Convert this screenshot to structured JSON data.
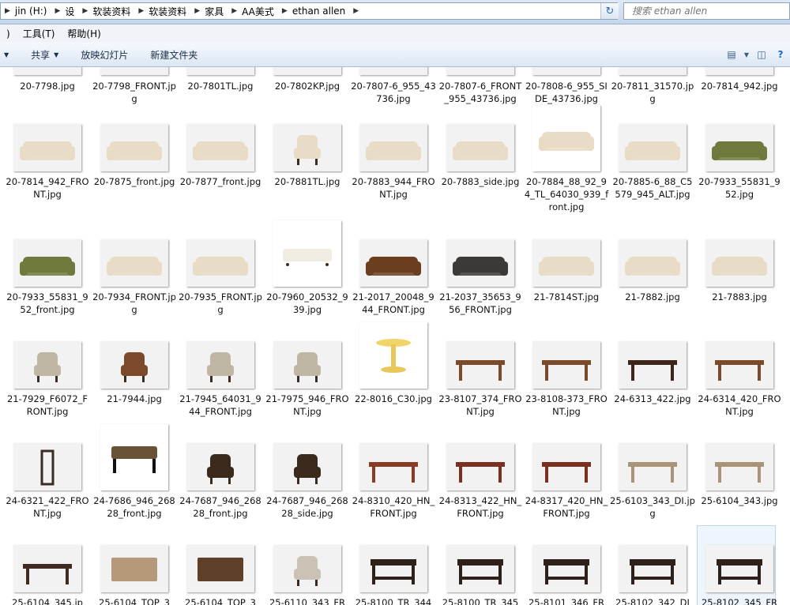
{
  "address": {
    "crumbs": [
      "jin (H:)",
      "设",
      "软装资料",
      "软装资料",
      "家具",
      "AA美式",
      "ethan allen"
    ],
    "search_placeholder": "搜索 ethan allen"
  },
  "menu": {
    "items": [
      ")",
      "工具(T)",
      "帮助(H)"
    ]
  },
  "commands": {
    "share": "共享",
    "slideshow": "放映幻灯片",
    "new_folder": "新建文件夹"
  },
  "files": [
    [
      "20-7798.jpg",
      "20-7798_FRONT.jpg",
      "20-7801TL.jpg",
      "20-7802KP.jpg",
      "20-7807-6_955_43736.jpg",
      "20-7807-6_FRONT_955_43736.jpg",
      "20-7808-6_955_SIDE_43736.jpg",
      "20-7811_31570.jpg",
      "20-7814_942.jpg"
    ],
    [
      "20-7814_942_FRONT.jpg",
      "20-7875_front.jpg",
      "20-7877_front.jpg",
      "20-7881TL.jpg",
      "20-7883_944_FRONT.jpg",
      "20-7883_side.jpg",
      "20-7884_88_92_94_TL_64030_939_front.jpg",
      "20-7885-6_88_C5579_945_ALT.jpg",
      "20-7933_55831_952.jpg"
    ],
    [
      "20-7933_55831_952_front.jpg",
      "20-7934_FRONT.jpg",
      "20-7935_FRONT.jpg",
      "20-7960_20532_939.jpg",
      "21-2017_20048_944_FRONT.jpg",
      "21-2037_35653_956_FRONT.jpg",
      "21-7814ST.jpg",
      "21-7882.jpg",
      "21-7883.jpg"
    ],
    [
      "21-7929_F6072_FRONT.jpg",
      "21-7944.jpg",
      "21-7945_64031_944_FRONT.jpg",
      "21-7975_946_FRONT.jpg",
      "22-8016_C30.jpg",
      "23-8107_374_FRONT.jpg",
      "23-8108-373_FRONT.jpg",
      "24-6313_422.jpg",
      "24-6314_420_FRONT.jpg"
    ],
    [
      "24-6321_422_FRONT.jpg",
      "24-7686_946_26828_front.jpg",
      "24-7687_946_26828_front.jpg",
      "24-7687_946_26828_side.jpg",
      "24-8310_420_HN_FRONT.jpg",
      "24-8313_422_HN_FRONT.jpg",
      "24-8317_420_HN_FRONT.jpg",
      "25-6103_343_DI.jpg",
      "25-6104_343.jpg"
    ],
    [
      "25-6104_345.jp",
      "25-6104_TOP_3",
      "25-6104_TOP_3",
      "25-6110_343_FR",
      "25-8100_TR_344",
      "25-8100_TR_345",
      "25-8101_346_FR",
      "25-8102_342_DI",
      "25-8102_345_FR"
    ]
  ],
  "colors": {
    "sofa_cream": "#e8dcc6",
    "sofa_green": "#6f7a3c",
    "wood": "#7a4a2a",
    "dark": "#3a2c22"
  }
}
